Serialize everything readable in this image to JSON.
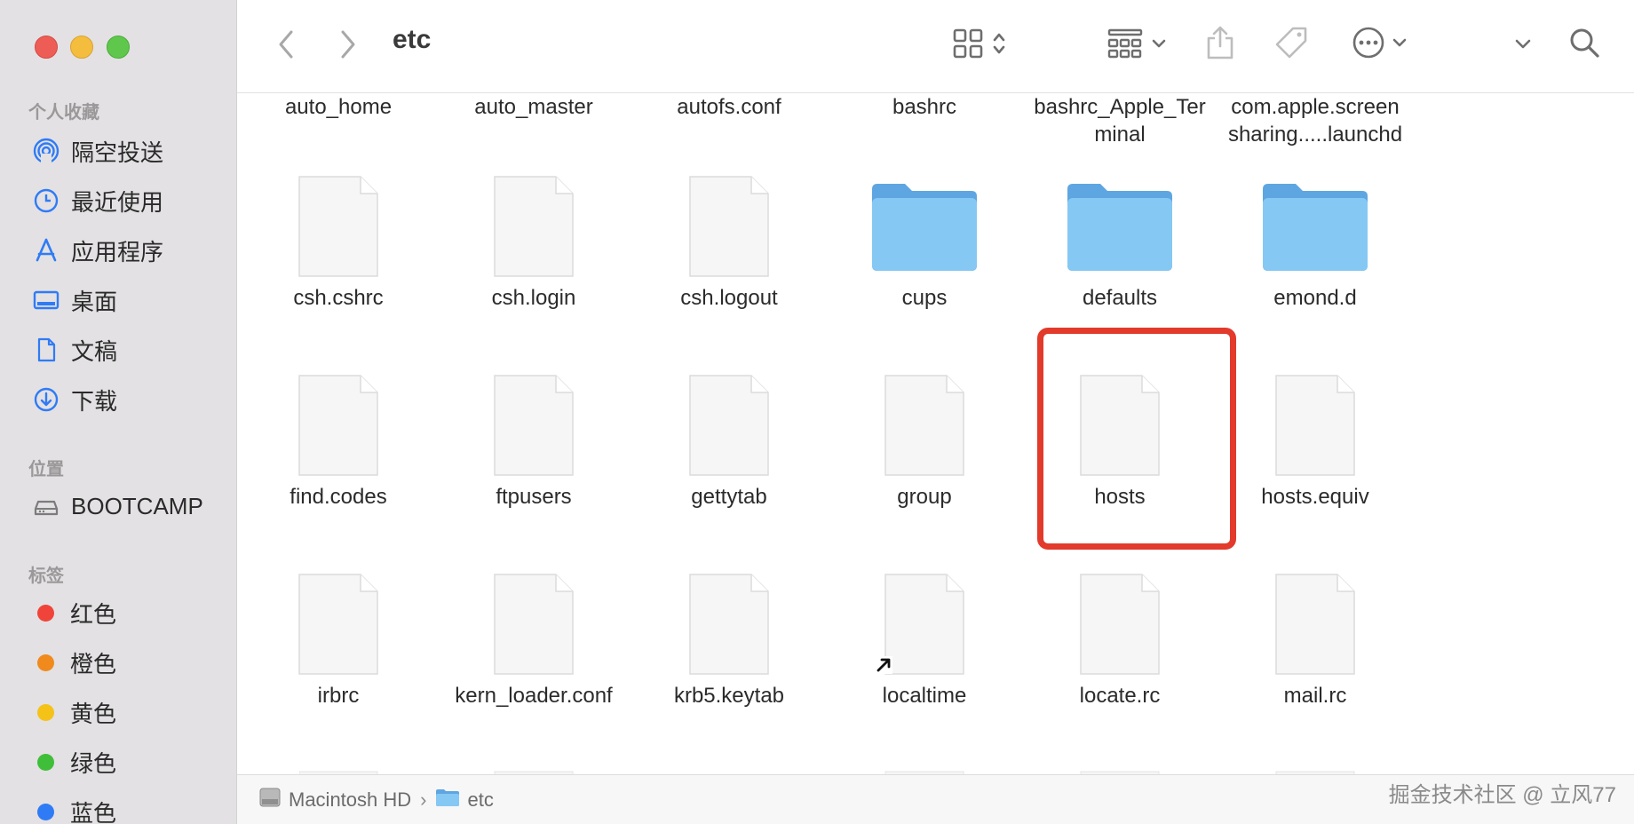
{
  "window": {
    "title": "etc"
  },
  "sidebar": {
    "favorites_title": "个人收藏",
    "favorites": [
      {
        "label": "隔空投送",
        "icon": "airdrop-icon"
      },
      {
        "label": "最近使用",
        "icon": "clock-icon"
      },
      {
        "label": "应用程序",
        "icon": "applications-icon"
      },
      {
        "label": "桌面",
        "icon": "desktop-icon"
      },
      {
        "label": "文稿",
        "icon": "document-icon"
      },
      {
        "label": "下载",
        "icon": "download-icon"
      }
    ],
    "locations_title": "位置",
    "locations": [
      {
        "label": "BOOTCAMP",
        "icon": "drive-icon"
      }
    ],
    "tags_title": "标签",
    "tags": [
      {
        "label": "红色",
        "color": "#f0443a"
      },
      {
        "label": "橙色",
        "color": "#f08a1d"
      },
      {
        "label": "黄色",
        "color": "#f5c218"
      },
      {
        "label": "绿色",
        "color": "#3fbe3a"
      },
      {
        "label": "蓝色",
        "color": "#2f7bf6"
      }
    ]
  },
  "files": {
    "row0": [
      {
        "name": "auto_home"
      },
      {
        "name": "auto_master"
      },
      {
        "name": "autofs.conf"
      },
      {
        "name": "bashrc"
      },
      {
        "name": "bashrc_Apple_Ter",
        "name2": "minal"
      },
      {
        "name": "com.apple.screen",
        "name2": "sharing.....launchd"
      }
    ],
    "row1": [
      {
        "name": "csh.cshrc",
        "type": "file"
      },
      {
        "name": "csh.login",
        "type": "file"
      },
      {
        "name": "csh.logout",
        "type": "file"
      },
      {
        "name": "cups",
        "type": "folder"
      },
      {
        "name": "defaults",
        "type": "folder"
      },
      {
        "name": "emond.d",
        "type": "folder"
      }
    ],
    "row2": [
      {
        "name": "find.codes",
        "type": "file"
      },
      {
        "name": "ftpusers",
        "type": "file"
      },
      {
        "name": "gettytab",
        "type": "file"
      },
      {
        "name": "group",
        "type": "file"
      },
      {
        "name": "hosts",
        "type": "file",
        "highlighted": true
      },
      {
        "name": "hosts.equiv",
        "type": "file"
      }
    ],
    "row3": [
      {
        "name": "irbrc",
        "type": "file"
      },
      {
        "name": "kern_loader.conf",
        "type": "file"
      },
      {
        "name": "krb5.keytab",
        "type": "file"
      },
      {
        "name": "localtime",
        "type": "alias"
      },
      {
        "name": "locate.rc",
        "type": "file"
      },
      {
        "name": "mail.rc",
        "type": "file"
      }
    ]
  },
  "pathbar": {
    "segments": [
      "Macintosh HD",
      "etc"
    ]
  },
  "watermark": "掘金技术社区 @ 立风77",
  "colors": {
    "sidebar_bg": "#e3e1e3",
    "accent": "#2f7bf6",
    "highlight": "#e23a2b",
    "folder": "#7ec3f2"
  }
}
